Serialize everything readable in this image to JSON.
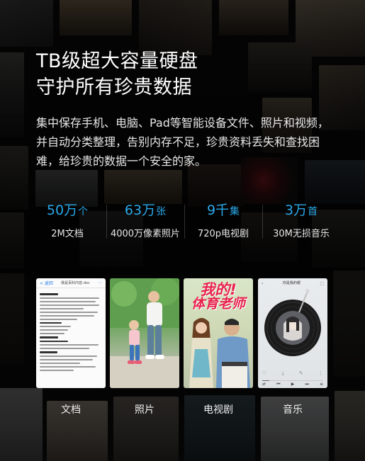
{
  "headline": {
    "line1": "TB级超大容量硬盘",
    "line2": "守护所有珍贵数据"
  },
  "description": "集中保存手机、电脑、Pad等智能设备文件、照片和视频，并自动分类整理，告别内存不足，珍贵资料丢失和查找困难，给珍贵的数据一个安全的家。",
  "stats": [
    {
      "value": "50万",
      "unit": "个",
      "label": "2M文档"
    },
    {
      "value": "63万",
      "unit": "张",
      "label": "4000万像素照片"
    },
    {
      "value": "9千",
      "unit": "集",
      "label": "720p电视剧"
    },
    {
      "value": "3万",
      "unit": "首",
      "label": "30M无损音乐"
    }
  ],
  "cards": {
    "document": {
      "back": "< 返回",
      "title": "我是百科内容.doc"
    },
    "tv": {
      "title_line1": "我的!",
      "title_line2": "体育老师"
    },
    "music": {
      "title": "你是我的眼",
      "progress": 0.12
    }
  },
  "labels": [
    "文档",
    "照片",
    "电视剧",
    "音乐"
  ],
  "colors": {
    "accent": "#29a8e8",
    "tv_title": "#e8234e"
  }
}
